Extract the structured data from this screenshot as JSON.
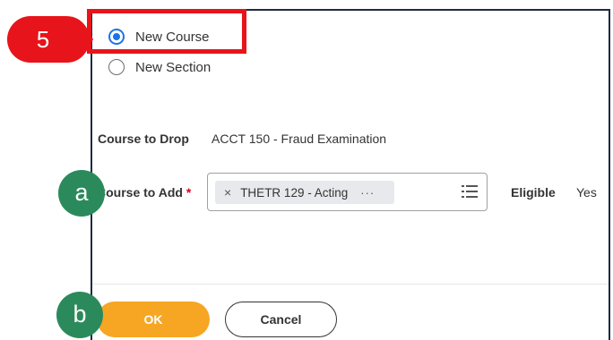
{
  "options": {
    "new_course": "New Course",
    "new_section": "New Section",
    "selected": "New Course"
  },
  "callouts": {
    "step": "5",
    "a": "a",
    "b": "b"
  },
  "form": {
    "course_to_drop_label": "Course to Drop",
    "course_to_drop_value": "ACCT 150 - Fraud Examination",
    "course_to_add_label": "Course to Add",
    "required_marker": "*",
    "course_to_add_value": "THETR 129 - Acting",
    "more_glyph": "···",
    "remove_glyph": "×",
    "eligible_label": "Eligible",
    "eligible_value": "Yes"
  },
  "buttons": {
    "ok": "OK",
    "cancel": "Cancel"
  },
  "colors": {
    "highlight": "#e8141b",
    "callout_green": "#2b8a5b",
    "ok_orange": "#f6a623",
    "radio_blue": "#1a73e8"
  },
  "icons": {
    "prompt": "list-icon"
  }
}
